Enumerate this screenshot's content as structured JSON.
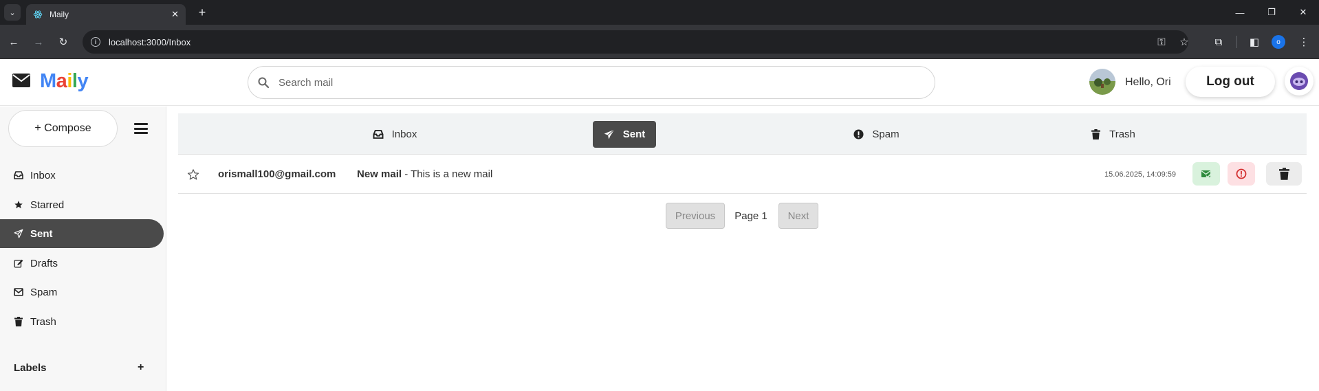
{
  "browser": {
    "tab_title": "Maily",
    "url": "localhost:3000/Inbox",
    "profile_initial": "o"
  },
  "header": {
    "logo_letters": [
      {
        "ch": "M",
        "color": "#4285F4"
      },
      {
        "ch": "a",
        "color": "#EA4335"
      },
      {
        "ch": "i",
        "color": "#FBBC05"
      },
      {
        "ch": "l",
        "color": "#34A853"
      },
      {
        "ch": "y",
        "color": "#4285F4"
      }
    ],
    "search_placeholder": "Search mail",
    "greeting": "Hello, Ori",
    "logout_label": "Log out"
  },
  "sidebar": {
    "compose_label": "+ Compose",
    "items": [
      {
        "label": "Inbox",
        "icon": "inbox-icon",
        "active": false
      },
      {
        "label": "Starred",
        "icon": "star-icon",
        "active": false
      },
      {
        "label": "Sent",
        "icon": "send-icon",
        "active": true
      },
      {
        "label": "Drafts",
        "icon": "edit-icon",
        "active": false
      },
      {
        "label": "Spam",
        "icon": "envelope-icon",
        "active": false
      },
      {
        "label": "Trash",
        "icon": "trash-icon",
        "active": false
      }
    ],
    "labels_title": "Labels",
    "labels_add": "+"
  },
  "folder_tabs": [
    {
      "label": "Inbox",
      "icon": "inbox-icon",
      "active": false
    },
    {
      "label": "Sent",
      "icon": "send-icon",
      "active": true
    },
    {
      "label": "Spam",
      "icon": "exclamation-circle-icon",
      "active": false
    },
    {
      "label": "Trash",
      "icon": "trash-icon",
      "active": false
    }
  ],
  "mails": [
    {
      "sender": "orismall100@gmail.com",
      "subject": "New mail",
      "separator": " - ",
      "snippet": "This is a new mail",
      "timestamp": "15.06.2025, 14:09:59"
    }
  ],
  "pagination": {
    "previous_label": "Previous",
    "page_label": "Page 1",
    "next_label": "Next"
  },
  "colors": {
    "active_bg": "#4a4a4a",
    "mark_read_bg": "#d9f2dd",
    "mark_read_fg": "#2e8b3d",
    "spam_bg": "#fde0e3",
    "spam_fg": "#d32f2f",
    "delete_bg": "#ececec"
  }
}
